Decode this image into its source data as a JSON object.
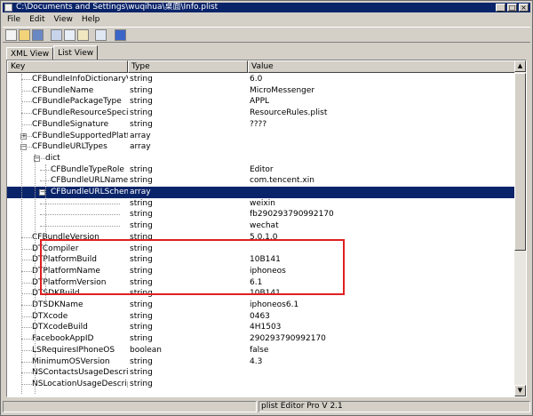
{
  "window": {
    "title": "C:\\Documents and Settings\\wuqihua\\桌面\\Info.plist",
    "min": "_",
    "max": "□",
    "close": "×"
  },
  "menu": [
    "File",
    "Edit",
    "View",
    "Help"
  ],
  "toolbar": [
    "new-icon",
    "open-icon",
    "save-icon",
    "cut-icon",
    "copy-icon",
    "paste-icon",
    "find-icon",
    "help-icon"
  ],
  "tabs": [
    "XML View",
    "List View"
  ],
  "columns": {
    "key": "Key",
    "type": "Type",
    "value": "Value"
  },
  "rows": [
    {
      "key": "CFBundleInfoDictionaryVersion",
      "type": "string",
      "value": "6.0"
    },
    {
      "key": "CFBundleName",
      "type": "string",
      "value": "MicroMessenger"
    },
    {
      "key": "CFBundlePackageType",
      "type": "string",
      "value": "APPL"
    },
    {
      "key": "CFBundleResourceSpecification",
      "type": "string",
      "value": "ResourceRules.plist"
    },
    {
      "key": "CFBundleSignature",
      "type": "string",
      "value": "????"
    },
    {
      "key": "CFBundleSupportedPlatforms",
      "type": "array",
      "value": ""
    },
    {
      "key": "CFBundleURLTypes",
      "type": "array",
      "value": ""
    },
    {
      "key": "dict",
      "type": "",
      "value": ""
    },
    {
      "key": "CFBundleTypeRole",
      "type": "string",
      "value": "Editor"
    },
    {
      "key": "CFBundleURLName",
      "type": "string",
      "value": "com.tencent.xin"
    },
    {
      "key": "CFBundleURLSchemes",
      "type": "array",
      "value": ""
    },
    {
      "key": "",
      "type": "string",
      "value": "weixin"
    },
    {
      "key": "",
      "type": "string",
      "value": "fb290293790992170"
    },
    {
      "key": "",
      "type": "string",
      "value": "wechat"
    },
    {
      "key": "CFBundleVersion",
      "type": "string",
      "value": "5.0.1.0"
    },
    {
      "key": "DTCompiler",
      "type": "string",
      "value": ""
    },
    {
      "key": "DTPlatformBuild",
      "type": "string",
      "value": "10B141"
    },
    {
      "key": "DTPlatformName",
      "type": "string",
      "value": "iphoneos"
    },
    {
      "key": "DTPlatformVersion",
      "type": "string",
      "value": "6.1"
    },
    {
      "key": "DTSDKBuild",
      "type": "string",
      "value": "10B141"
    },
    {
      "key": "DTSDKName",
      "type": "string",
      "value": "iphoneos6.1"
    },
    {
      "key": "DTXcode",
      "type": "string",
      "value": "0463"
    },
    {
      "key": "DTXcodeBuild",
      "type": "string",
      "value": "4H1503"
    },
    {
      "key": "FacebookAppID",
      "type": "string",
      "value": "290293790992170"
    },
    {
      "key": "LSRequiresIPhoneOS",
      "type": "boolean",
      "value": "false"
    },
    {
      "key": "MinimumOSVersion",
      "type": "string",
      "value": "4.3"
    },
    {
      "key": "NSContactsUsageDescription",
      "type": "string",
      "value": ""
    },
    {
      "key": "NSLocationUsageDescription",
      "type": "string",
      "value": ""
    }
  ],
  "status": {
    "text": "plist Editor Pro V 2.1"
  },
  "colors": {
    "selection": "#0a246a",
    "annotation_box": "#e02020",
    "face": "#d4d0c8"
  }
}
